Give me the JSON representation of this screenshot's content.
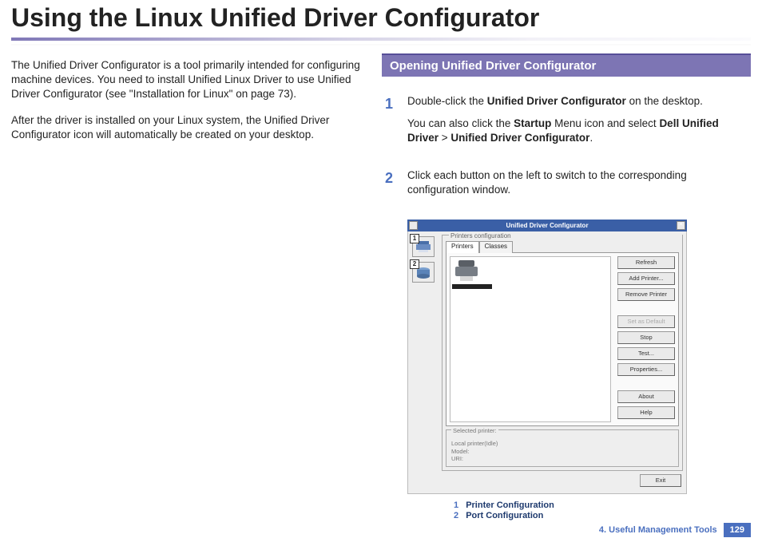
{
  "page_title": "Using the Linux Unified Driver Configurator",
  "intro": {
    "p1": "The Unified Driver Configurator is a tool primarily intended for configuring machine devices. You need to install Unified Linux Driver to use Unified Driver Configurator (see \"Installation for Linux\" on page 73).",
    "p2": "After the driver is installed on your Linux system, the Unified Driver Configurator icon will automatically be created on your desktop."
  },
  "section_heading": "Opening Unified Driver Configurator",
  "steps": {
    "s1": {
      "num": "1",
      "l1a": "Double-click the ",
      "l1b": "Unified Driver Configurator",
      "l1c": " on the desktop.",
      "l2a": "You can also click the ",
      "l2b": "Startup",
      "l2c": " Menu icon and select ",
      "l2d": "Dell Unified Driver",
      "l2e": " > ",
      "l2f": "Unified Driver Configurator",
      "l2g": "."
    },
    "s2": {
      "num": "2",
      "text": "Click each button on the left to switch to the corresponding configuration window."
    }
  },
  "app": {
    "title": "Unified Driver Configurator",
    "fieldset_label": "Printers configuration",
    "tabs": {
      "t1": "Printers",
      "t2": "Classes"
    },
    "buttons": {
      "refresh": "Refresh",
      "add": "Add Printer...",
      "remove": "Remove Printer",
      "setdefault": "Set as Default",
      "stop": "Stop",
      "test": "Test...",
      "properties": "Properties...",
      "about": "About",
      "help": "Help",
      "exit": "Exit"
    },
    "selected": {
      "legend": "Selected printer:",
      "l1": "Local printer(Idle)",
      "l2": "Model:",
      "l3": "URI:"
    },
    "callouts": {
      "c1": "1",
      "c2": "2"
    }
  },
  "legend": {
    "r1": {
      "num": "1",
      "text": "Printer Configuration"
    },
    "r2": {
      "num": "2",
      "text": "Port Configuration"
    }
  },
  "footer": {
    "chapter": "4.  Useful Management Tools",
    "page": "129"
  }
}
